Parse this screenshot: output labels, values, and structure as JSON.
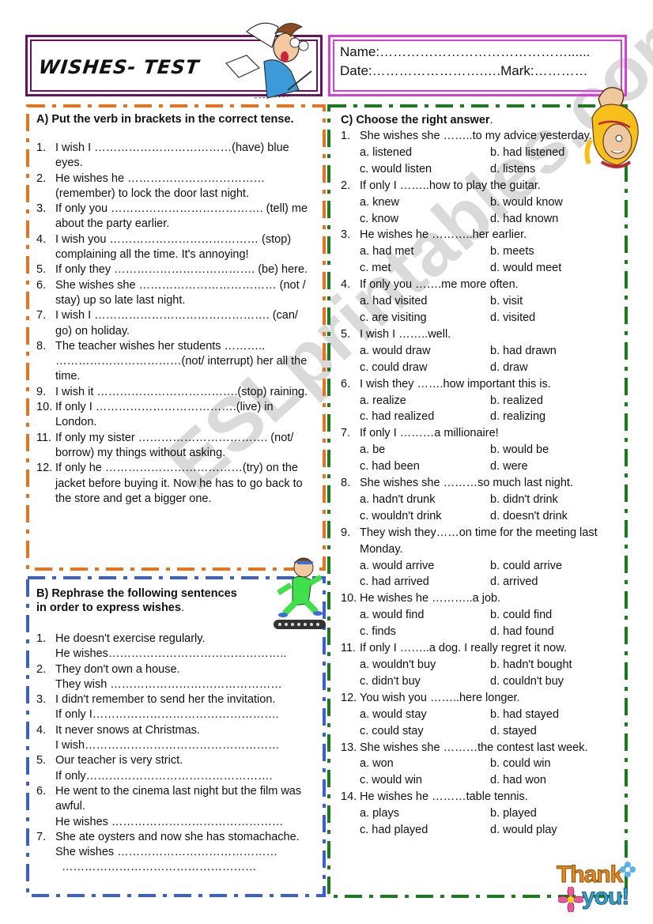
{
  "header": {
    "title": "WISHES- TEST",
    "name_label": "Name:……………………………………......",
    "date_label": "Date:…………………….….Mark:…………"
  },
  "colors": {
    "title_border": "#6b1060",
    "name_border": "#d43fd4",
    "section_a_border": "#e8731e",
    "section_b_border": "#3a5fd0",
    "section_c_border": "#1e7a1e"
  },
  "section_a": {
    "heading": "A) Put the verb in brackets in the correct tense.",
    "items": [
      {
        "num": "1.",
        "text": "I wish I ………………………………(have) blue eyes."
      },
      {
        "num": "2.",
        "text": "He wishes he ……………………………… (remember) to lock the door last night."
      },
      {
        "num": "3.",
        "text": "If only you …………………………………. (tell) me about the party earlier."
      },
      {
        "num": "4.",
        "text": "I wish you ………………………………… (stop) complaining all the time. It's annoying!"
      },
      {
        "num": "5.",
        "text": "If only they ………………………………. (be) here."
      },
      {
        "num": "6.",
        "text": "She wishes she ……………………………… (not / stay) up so late last night."
      },
      {
        "num": "7.",
        "text": "I wish I ………………………………………. (can/ go) on holiday."
      },
      {
        "num": "8.",
        "text": "The teacher wishes her students ……….. ……………………………(not/ interrupt) her all the time."
      },
      {
        "num": "9.",
        "text": "I wish it ……………………………….(stop) raining."
      },
      {
        "num": "10.",
        "text": "If only I ……………………………….(live) in London."
      },
      {
        "num": "11.",
        "text": "If only my sister ……………………………. (not/ borrow) my things without asking."
      },
      {
        "num": "12.",
        "text": "If only he ………………………………(try) on the jacket before buying it. Now he has to go back to the store and get a bigger one."
      }
    ]
  },
  "section_b": {
    "heading_line1": "B) Rephrase the following sentences",
    "heading_line2": " in order to express wishes",
    "heading_tail": ".",
    "items": [
      {
        "num": "1.",
        "lines": [
          "He doesn't exercise regularly.",
          "He wishes……………………………………….."
        ]
      },
      {
        "num": "2.",
        "lines": [
          "They don't own a house.",
          "They wish ………………………………………"
        ]
      },
      {
        "num": "3.",
        "lines": [
          "I didn't remember to send her the invitation.",
          "If only I…………………………………………."
        ]
      },
      {
        "num": "4.",
        "lines": [
          "It never snows at Christmas.",
          "I wish……………………………………………"
        ]
      },
      {
        "num": "5.",
        "lines": [
          "Our teacher is very strict.",
          "If only…………………………………………."
        ]
      },
      {
        "num": "6.",
        "lines": [
          "He went to the cinema last night but the film was awful.",
          "He wishes ………………………………………"
        ]
      },
      {
        "num": "7.",
        "lines": [
          "She ate oysters and now she has stomachache.",
          "She wishes ……………………………………",
          "  ……………………………………………"
        ]
      }
    ]
  },
  "section_c": {
    "heading": "C) Choose the right answer",
    "heading_tail": ".",
    "items": [
      {
        "num": "1.",
        "text": "She wishes she ……..to my advice yesterday.",
        "a": "a. listened",
        "b": "b. had listened",
        "c": "c. would listen",
        "d": "d. listens"
      },
      {
        "num": "2.",
        "text": "If only I ……..how to play the guitar.",
        "a": "a. knew",
        "b": "b. would know",
        "c": "c. know",
        "d": "d. had known"
      },
      {
        "num": "3.",
        "text": "He wishes he ………..her earlier.",
        "a": "a. had met",
        "b": "b. meets",
        "c": "c. met",
        "d": "d. would meet"
      },
      {
        "num": "4.",
        "text": "If only you …….me more often.",
        "a": "a. had visited",
        "b": "b. visit",
        "c": "c. are visiting",
        "d": "d. visited"
      },
      {
        "num": "5.",
        "text": "I wish I ……..well.",
        "a": "a. would draw",
        "b": "b. had drawn",
        "c": "c. could draw",
        "d": "d. draw"
      },
      {
        "num": "6.",
        "text": "I wish they …….how important this is.",
        "a": "a. realize",
        "b": "b. realized",
        "c": "c. had realized",
        "d": "d. realizing"
      },
      {
        "num": "7.",
        "text": "If only I ………a millionaire!",
        "a": "a. be",
        "b": "b. would be",
        "c": "c. had been",
        "d": "d. were"
      },
      {
        "num": "8.",
        "text": "She wishes she ………so much last night.",
        "a": "a. hadn't drunk",
        "b": "b. didn't drink",
        "c": "c. wouldn't drink",
        "d": "d. doesn't drink"
      },
      {
        "num": "9.",
        "text": "They wish they……on time for the meeting last Monday.",
        "a": "a. would arrive",
        "b": "b. could arrive",
        "c": "c. had arrived",
        "d": "d. arrived"
      },
      {
        "num": "10.",
        "text": "He wishes he ………..a job.",
        "a": "a. would find",
        "b": "b. could find",
        "c": "c. finds",
        "d": "d. had found"
      },
      {
        "num": "11.",
        "text": "If only I ……..a dog. I really regret it now.",
        "a": "a. wouldn't buy",
        "b": "b. hadn't bought",
        "c": "c. didn't buy",
        "d": "d. couldn't buy"
      },
      {
        "num": "12.",
        "text": "You wish you ……..here longer.",
        "a": "a. would stay",
        "b": "b. had stayed",
        "c": "c. could stay",
        "d": "d. stayed"
      },
      {
        "num": "13.",
        "text": "She wishes she ………the contest last week.",
        "a": "a. won",
        "b": "b. could win",
        "c": "c. would win",
        "d": "d. had won"
      },
      {
        "num": "14.",
        "text": "He wishes he ………table tennis.",
        "a": "a. plays",
        "b": "b. played",
        "c": "c. had played",
        "d": "d. would play"
      }
    ]
  },
  "decor": {
    "thank_you_line1": "Thank",
    "thank_you_line2": "you!",
    "watermark": "ESLprintables.com"
  }
}
